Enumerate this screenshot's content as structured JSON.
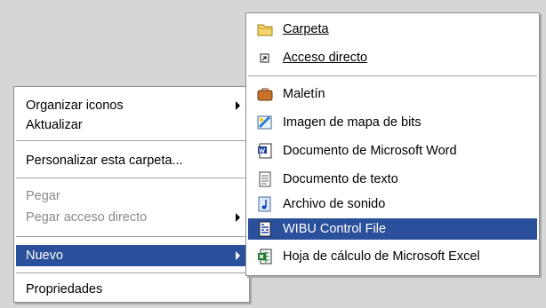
{
  "context_menu": {
    "items": [
      {
        "label": "Organizar iconos"
      },
      {
        "label": "Aktualizar"
      },
      {
        "label": "Personalizar esta carpeta..."
      },
      {
        "label": "Pegar"
      },
      {
        "label": "Pegar acceso directo"
      },
      {
        "label": "Nuevo"
      },
      {
        "label": "Propriedades"
      }
    ]
  },
  "submenu": {
    "items": [
      {
        "label": "Carpeta",
        "icon": "folder-icon"
      },
      {
        "label": "Acceso directo",
        "icon": "shortcut-icon"
      },
      {
        "label": "Maletín",
        "icon": "briefcase-icon"
      },
      {
        "label": "Imagen de mapa de bits",
        "icon": "bitmap-image-icon"
      },
      {
        "label": "Documento de Microsoft Word",
        "icon": "word-document-icon"
      },
      {
        "label": "Documento de texto",
        "icon": "text-document-icon"
      },
      {
        "label": "Archivo de sonido",
        "icon": "sound-file-icon"
      },
      {
        "label": "WIBU Control File",
        "icon": "wibu-control-file-icon"
      },
      {
        "label": "Hoja de cálculo de Microsoft Excel",
        "icon": "excel-spreadsheet-icon"
      }
    ]
  },
  "colors": {
    "selection": "#2a4f9b",
    "menu_background": "#ffffff",
    "desktop_background": "#d6d6d6",
    "disabled_text": "#8a8a8a"
  }
}
